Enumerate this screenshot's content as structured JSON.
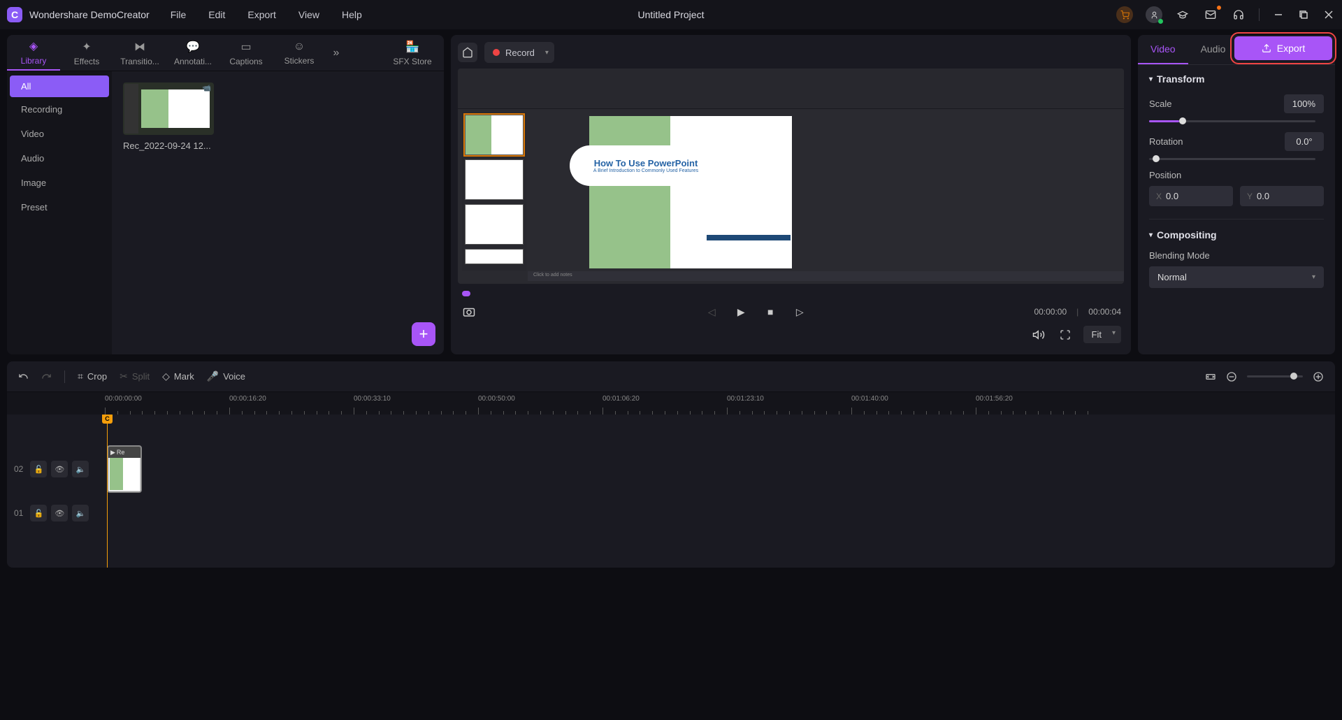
{
  "app": {
    "name": "Wondershare DemoCreator",
    "project_title": "Untitled Project"
  },
  "menu": {
    "file": "File",
    "edit": "Edit",
    "export": "Export",
    "view": "View",
    "help": "Help"
  },
  "library": {
    "tabs": {
      "library": "Library",
      "effects": "Effects",
      "transitions": "Transitio...",
      "annotations": "Annotati...",
      "captions": "Captions",
      "stickers": "Stickers",
      "sfx": "SFX Store"
    },
    "sidebar": [
      "All",
      "Recording",
      "Video",
      "Audio",
      "Image",
      "Preset"
    ],
    "clip_name": "Rec_2022-09-24 12..."
  },
  "record": {
    "label": "Record"
  },
  "export_btn": "Export",
  "preview": {
    "slide_title": "How To Use PowerPoint",
    "slide_subtitle": "A Brief Introduction to Commonly Used Features",
    "notes_placeholder": "Click to add notes",
    "time_current": "00:00:00",
    "time_total": "00:00:04",
    "fit": "Fit"
  },
  "props": {
    "tab_video": "Video",
    "tab_audio": "Audio",
    "transform": "Transform",
    "scale_label": "Scale",
    "scale_value": "100%",
    "rotation_label": "Rotation",
    "rotation_value": "0.0°",
    "position_label": "Position",
    "pos_x": "0.0",
    "pos_y": "0.0",
    "compositing": "Compositing",
    "blend_label": "Blending Mode",
    "blend_value": "Normal"
  },
  "timeline": {
    "crop": "Crop",
    "split": "Split",
    "mark": "Mark",
    "voice": "Voice",
    "ruler": [
      "00:00:00:00",
      "00:00:16:20",
      "00:00:33:10",
      "00:00:50:00",
      "00:01:06:20",
      "00:01:23:10",
      "00:01:40:00",
      "00:01:56:20"
    ],
    "track02": "02",
    "track01": "01",
    "clip_label": "Re",
    "playhead": "C"
  }
}
